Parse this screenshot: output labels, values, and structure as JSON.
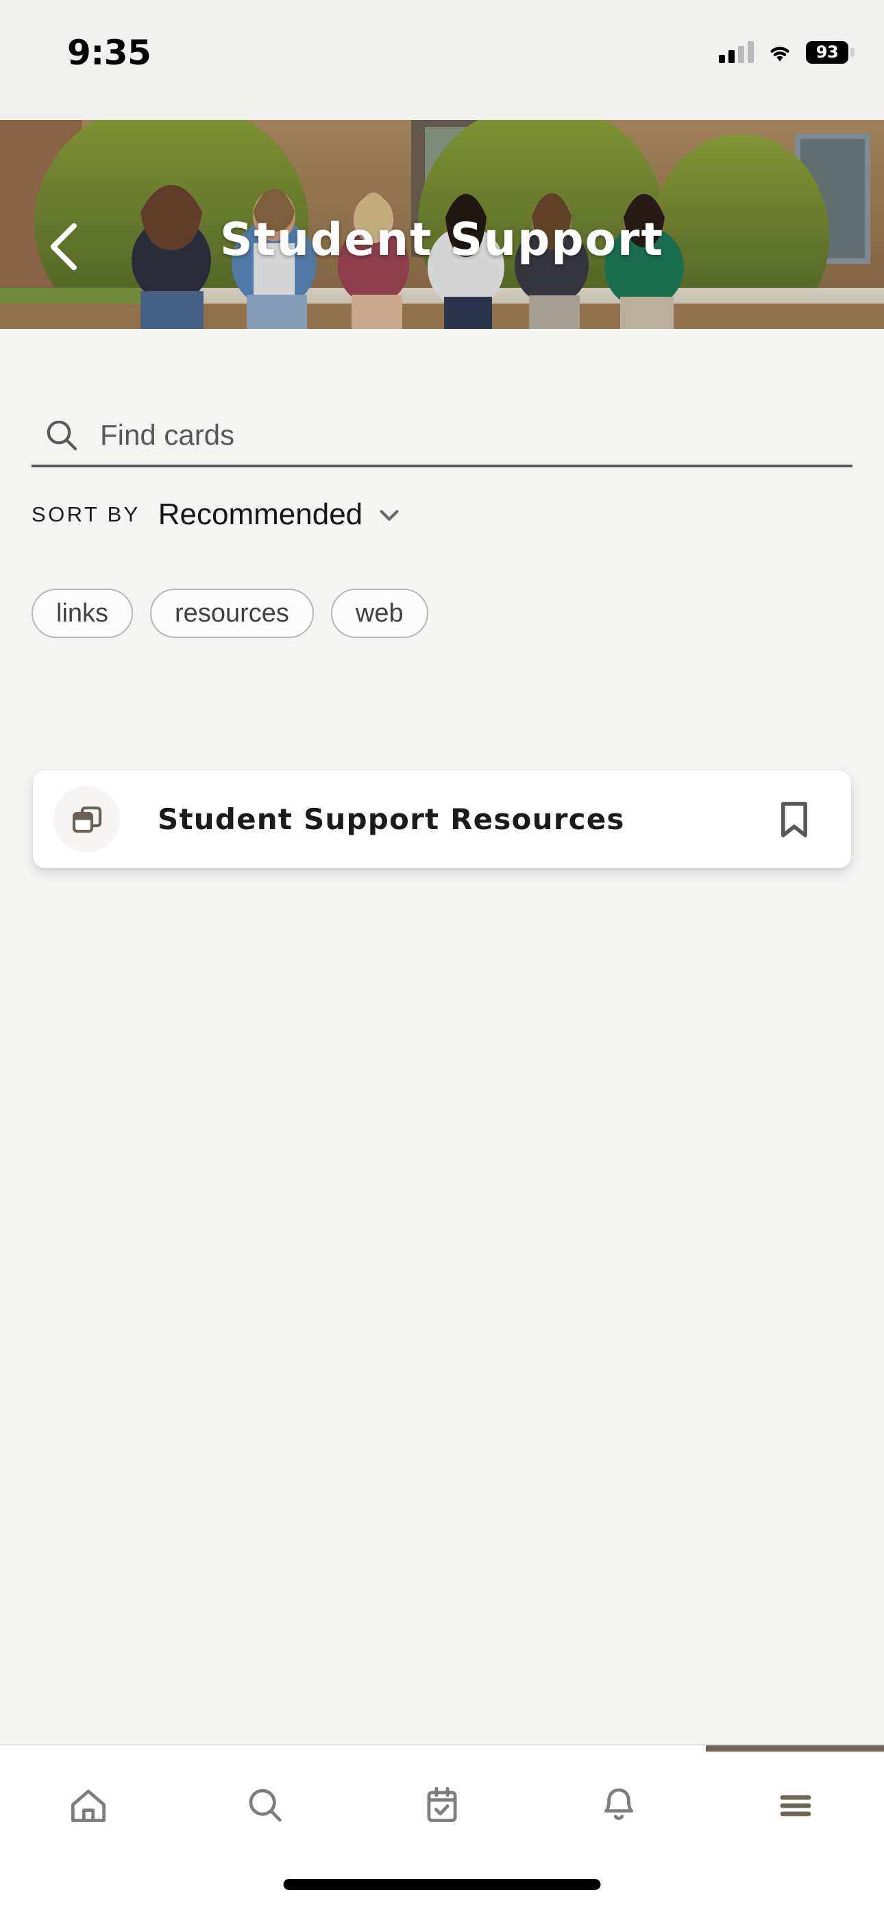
{
  "status_bar": {
    "time": "9:35",
    "battery_percent": "93",
    "cellular_icon": "cellular-signal-icon",
    "wifi_icon": "wifi-icon",
    "battery_icon": "battery-icon"
  },
  "header": {
    "title": "Student Support",
    "back_icon": "chevron-left-icon",
    "hero_image_alt": "students-sitting-outside-campus"
  },
  "search": {
    "placeholder": "Find cards",
    "value": "",
    "icon": "search-icon"
  },
  "sort": {
    "label": "SORT BY",
    "value": "Recommended",
    "caret_icon": "chevron-down-icon"
  },
  "filters": {
    "chips": [
      {
        "label": "links"
      },
      {
        "label": "resources"
      },
      {
        "label": "web"
      }
    ]
  },
  "results": {
    "cards": [
      {
        "title": "Student Support Resources",
        "type_icon": "cards-stack-icon",
        "bookmark_icon": "bookmark-outline-icon"
      }
    ]
  },
  "tabbar": {
    "active_index": 4,
    "items": [
      {
        "name": "home",
        "icon": "home-icon"
      },
      {
        "name": "search",
        "icon": "search-icon"
      },
      {
        "name": "calendar",
        "icon": "calendar-check-icon"
      },
      {
        "name": "notifications",
        "icon": "bell-icon"
      },
      {
        "name": "menu",
        "icon": "hamburger-menu-icon"
      }
    ]
  },
  "colors": {
    "brand_brown": "#706559",
    "page_background": "#f4f4f3",
    "card_background": "#ffffff",
    "icon_gray": "#7d7d7d",
    "text_dark": "#1b1b1b"
  }
}
